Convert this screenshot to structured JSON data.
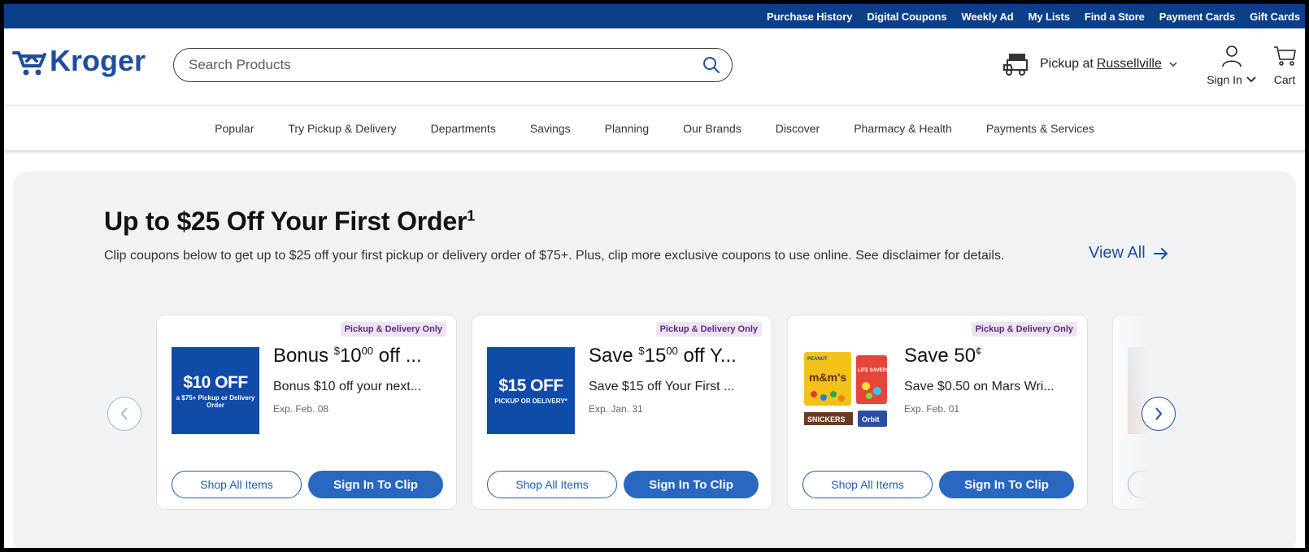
{
  "utility_links": [
    "Purchase History",
    "Digital Coupons",
    "Weekly Ad",
    "My Lists",
    "Find a Store",
    "Payment Cards",
    "Gift Cards"
  ],
  "header": {
    "logo_text": "Kroger",
    "search_placeholder": "Search Products",
    "pickup_prefix": "Pickup at",
    "pickup_location": "Russellville",
    "signin_label": "Sign In",
    "cart_label": "Cart"
  },
  "nav": [
    "Popular",
    "Try Pickup & Delivery",
    "Departments",
    "Savings",
    "Planning",
    "Our Brands",
    "Discover",
    "Pharmacy & Health",
    "Payments & Services"
  ],
  "promo": {
    "title": "Up to $25 Off Your First Order",
    "title_sup": "1",
    "subtitle": "Clip coupons below to get up to $25 off your first pickup or delivery order of $75+. Plus, clip more exclusive coupons to use online. See disclaimer for details.",
    "view_all": "View All"
  },
  "cards": [
    {
      "badge": "Pickup & Delivery Only",
      "thumb_big": "$10 OFF",
      "thumb_small": "a $75+ Pickup or Delivery Order",
      "title_pre": "Bonus ",
      "title_amount": "10",
      "title_cents": "00",
      "title_post": " off ...",
      "desc": "Bonus $10 off your next...",
      "exp": "Exp. Feb. 08",
      "btn_shop": "Shop All Items",
      "btn_clip": "Sign In To Clip"
    },
    {
      "badge": "Pickup & Delivery Only",
      "thumb_big": "$15 OFF",
      "thumb_small": "PICKUP OR DELIVERY*",
      "title_pre": "Save ",
      "title_amount": "15",
      "title_cents": "00",
      "title_post": " off Y...",
      "desc": "Save $15 off Your First ...",
      "exp": "Exp. Jan. 31",
      "btn_shop": "Shop All Items",
      "btn_clip": "Sign In To Clip"
    },
    {
      "badge": "Pickup & Delivery Only",
      "title_pre": "Save 50",
      "title_cent_sign": "¢",
      "desc": "Save $0.50 on Mars Wri...",
      "exp": "Exp. Feb. 01",
      "btn_shop": "Shop All Items",
      "btn_clip": "Sign In To Clip",
      "product_labels": [
        "PEANUT",
        "m&m's",
        "LIFE SAVERS",
        "SNICKERS",
        "Orbit"
      ]
    }
  ],
  "colors": {
    "utility_bar": "#0b3f8a",
    "brand_blue": "#1f4e9c",
    "clip_button": "#2a67c1",
    "badge_bg": "#ede4f3",
    "badge_text": "#5b2a85",
    "promo_bg": "#f1f2f4"
  }
}
